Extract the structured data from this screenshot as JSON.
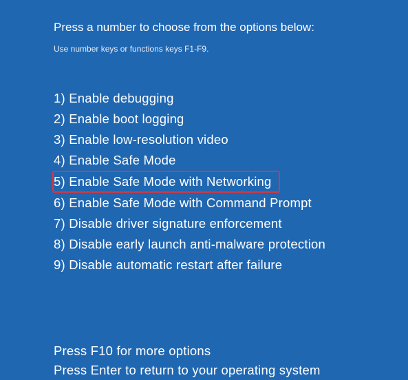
{
  "heading": "Press a number to choose from the options below:",
  "subheading": "Use number keys or functions keys F1-F9.",
  "options": [
    {
      "label": "1) Enable debugging",
      "highlighted": false
    },
    {
      "label": "2) Enable boot logging",
      "highlighted": false
    },
    {
      "label": "3) Enable low-resolution video",
      "highlighted": false
    },
    {
      "label": "4) Enable Safe Mode",
      "highlighted": false
    },
    {
      "label": "5) Enable Safe Mode with Networking",
      "highlighted": true
    },
    {
      "label": "6) Enable Safe Mode with Command Prompt",
      "highlighted": false
    },
    {
      "label": "7) Disable driver signature enforcement",
      "highlighted": false
    },
    {
      "label": "8) Disable early launch anti-malware protection",
      "highlighted": false
    },
    {
      "label": "9) Disable automatic restart after failure",
      "highlighted": false
    }
  ],
  "footer": {
    "line1": "Press F10 for more options",
    "line2": "Press Enter to return to your operating system"
  },
  "colors": {
    "background": "#2067b2",
    "text": "#ffffff",
    "highlight_border": "#d9363e"
  }
}
